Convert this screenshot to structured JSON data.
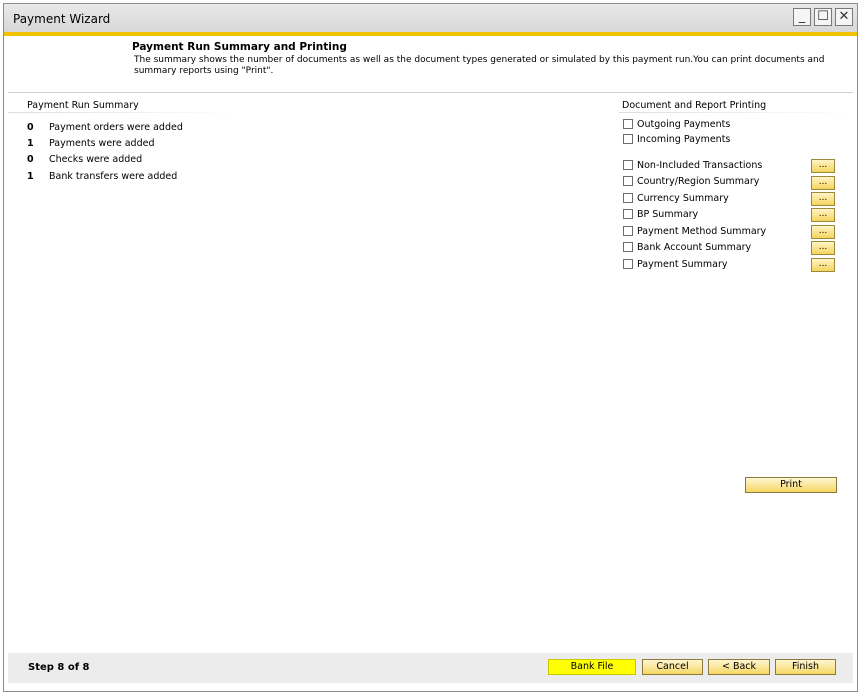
{
  "window": {
    "title": "Payment Wizard"
  },
  "header": {
    "title": "Payment Run Summary and Printing",
    "description": "The summary shows the number of documents as well as the document types generated or simulated by this payment run.You can print documents and summary reports using \"Print\"."
  },
  "summary": {
    "label": "Payment Run Summary",
    "rows": [
      {
        "count": "0",
        "text": "Payment orders were added"
      },
      {
        "count": "1",
        "text": "Payments were added"
      },
      {
        "count": "0",
        "text": "Checks were added"
      },
      {
        "count": "1",
        "text": "Bank transfers were added"
      }
    ]
  },
  "printing": {
    "label": "Document and Report Printing",
    "documents": [
      {
        "label": "Outgoing Payments",
        "checked": false
      },
      {
        "label": "Incoming Payments",
        "checked": false
      }
    ],
    "reports": [
      {
        "label": "Non-Included Transactions",
        "checked": false
      },
      {
        "label": "Country/Region Summary",
        "checked": false
      },
      {
        "label": "Currency Summary",
        "checked": false
      },
      {
        "label": "BP Summary",
        "checked": false
      },
      {
        "label": "Payment Method Summary",
        "checked": false
      },
      {
        "label": "Bank Account Summary",
        "checked": false
      },
      {
        "label": "Payment Summary",
        "checked": false
      }
    ],
    "dots_label": "...",
    "print_label": "Print"
  },
  "footer": {
    "step": "Step 8 of 8",
    "bank_file": "Bank File",
    "cancel": "Cancel",
    "back": "< Back",
    "finish": "Finish"
  },
  "colors": {
    "accent": "#f2c200",
    "button": "#f6d764",
    "highlight": "#ffff00"
  }
}
